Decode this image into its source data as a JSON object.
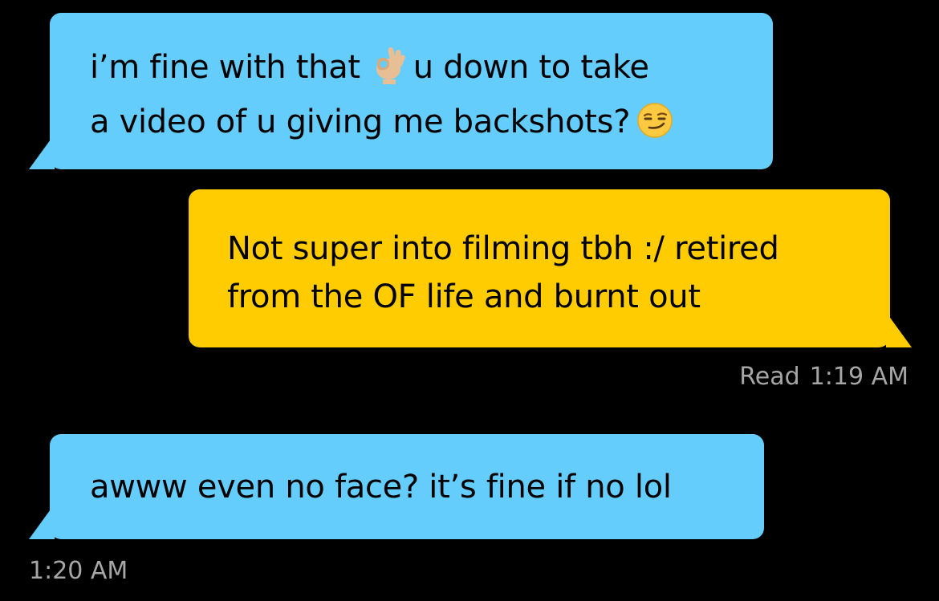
{
  "conversation": {
    "messages": [
      {
        "direction": "incoming",
        "bubble_color": "#64CDFC",
        "line1_before_emoji": "i’m fine with that",
        "line1_emoji": "ok-hand-emoji",
        "line1_after_emoji": "u down to take",
        "line2_text": "a video of u giving me backshots?",
        "line2_emoji": "smirking-face-emoji"
      },
      {
        "direction": "outgoing",
        "bubble_color": "#FECC00",
        "line1": "Not super into filming tbh :/ retired",
        "line2": "from the OF life and burnt out",
        "status_label": "Read",
        "status_time": "1:19 AM"
      },
      {
        "direction": "incoming",
        "bubble_color": "#64CDFC",
        "line1": "awww even no face? it’s fine if no lol",
        "time": "1:20 AM"
      }
    ]
  }
}
